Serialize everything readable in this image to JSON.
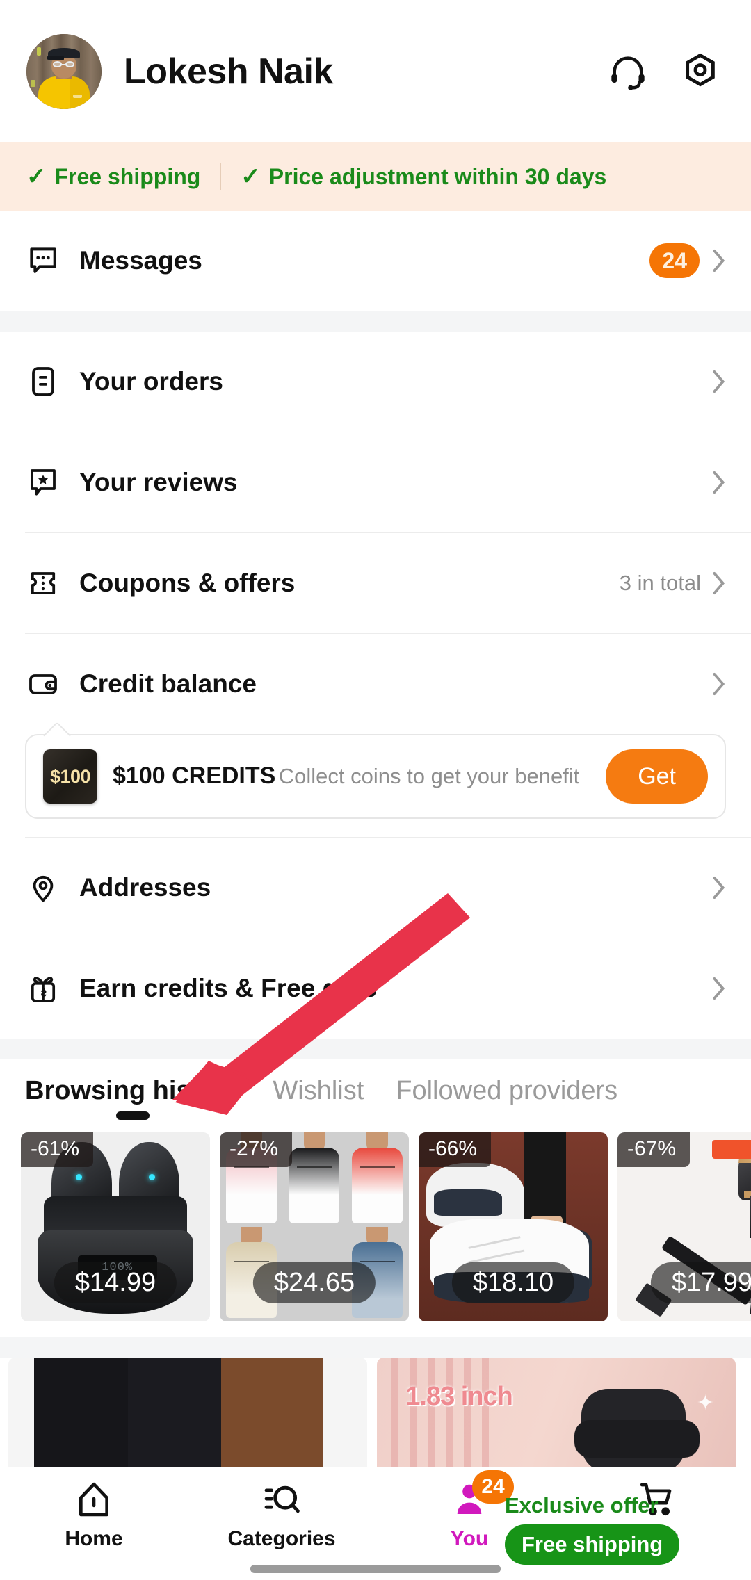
{
  "header": {
    "user_name": "Lokesh Naik",
    "avatar_alt": "user-avatar",
    "support_icon": "headset-icon",
    "settings_icon": "hexagon-gear-icon"
  },
  "promo_banner": {
    "check_glyph": "✓",
    "items": [
      {
        "label": "Free shipping"
      },
      {
        "label": "Price adjustment within 30 days"
      }
    ],
    "text_color": "#1a8a1a",
    "background": "#fdece0"
  },
  "messages_row": {
    "label": "Messages",
    "icon": "chat-bubble-icon",
    "badge": "24",
    "badge_color": "#f57505"
  },
  "menu": {
    "items": [
      {
        "label": "Your orders",
        "icon": "receipt-icon",
        "meta": ""
      },
      {
        "label": "Your reviews",
        "icon": "review-star-icon",
        "meta": ""
      },
      {
        "label": "Coupons & offers",
        "icon": "ticket-icon",
        "meta": "3 in total"
      },
      {
        "label": "Credit balance",
        "icon": "wallet-icon",
        "meta": ""
      },
      {
        "label": "Addresses",
        "icon": "location-pin-icon",
        "meta": ""
      },
      {
        "label": "Earn credits & Free gifts",
        "icon": "gift-icon",
        "meta": ""
      }
    ]
  },
  "credit_card": {
    "coin_label": "$100",
    "title": "$100 CREDITS",
    "subtitle": "Collect coins to get your benefit",
    "button_label": "Get",
    "button_color": "#f57b11"
  },
  "tabs": {
    "items": [
      {
        "label": "Browsing history",
        "active": true
      },
      {
        "label": "Wishlist",
        "active": false
      },
      {
        "label": "Followed providers",
        "active": false
      }
    ]
  },
  "browsing_history": {
    "products": [
      {
        "name": "wireless-earbuds",
        "discount": "-61%",
        "price": "$14.99",
        "display": "100%"
      },
      {
        "name": "gradient-t-shirts",
        "discount": "-27%",
        "price": "$24.65"
      },
      {
        "name": "sneakers",
        "discount": "-66%",
        "price": "$18.10"
      },
      {
        "name": "handheld-vacuum",
        "discount": "-67%",
        "price": "$17.99"
      }
    ]
  },
  "recommendations": {
    "items": [
      {
        "name": "long-sleeve-shirts",
        "caption": ""
      },
      {
        "name": "smart-watch",
        "caption": "1.83 inch"
      }
    ]
  },
  "bottom_nav": {
    "items": [
      {
        "label": "Home",
        "icon": "home-icon",
        "active": false,
        "badge": ""
      },
      {
        "label": "Categories",
        "icon": "categories-icon",
        "active": false,
        "badge": ""
      },
      {
        "label": "You",
        "icon": "person-icon",
        "active": true,
        "badge": "24"
      },
      {
        "label": "Cart",
        "icon": "cart-icon",
        "active": false,
        "badge": ""
      }
    ],
    "offer_text": "Exclusive offer",
    "offer_pill": "Free shipping",
    "active_color": "#d119bd"
  },
  "annotation": {
    "arrow_color": "#e8334a",
    "points_to": "Browsing history"
  }
}
